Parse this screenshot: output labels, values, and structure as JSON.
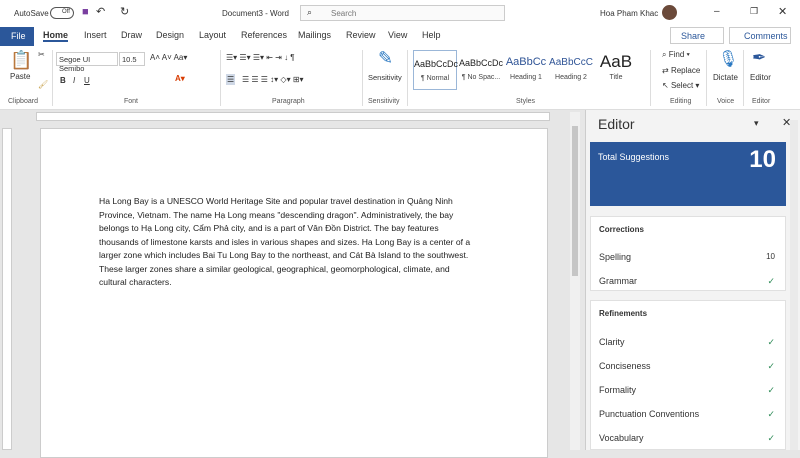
{
  "titlebar": {
    "autosave": "AutoSave",
    "toggle": "Off",
    "doc_title": "Document3 - Word",
    "search_placeholder": "Search",
    "user": "Hoa Pham Khac"
  },
  "tabs": [
    "File",
    "Home",
    "Insert",
    "Draw",
    "Design",
    "Layout",
    "References",
    "Mailings",
    "Review",
    "View",
    "Help"
  ],
  "share": "Share",
  "comments": "Comments",
  "ribbon": {
    "paste": "Paste",
    "font": "Segoe UI Semibo",
    "size": "10.5",
    "styles": [
      {
        "sample": "AaBbCcDc",
        "label": "¶ Normal"
      },
      {
        "sample": "AaBbCcDc",
        "label": "¶ No Spac..."
      },
      {
        "sample": "AaBbCc",
        "label": "Heading 1"
      },
      {
        "sample": "AaBbCcC",
        "label": "Heading 2"
      },
      {
        "sample": "AaB",
        "label": "Title"
      }
    ],
    "find": "Find",
    "replace": "Replace",
    "select": "Select",
    "sensitivity": "Sensitivity",
    "dictate": "Dictate",
    "editor": "Editor",
    "groups": [
      "Clipboard",
      "Font",
      "Paragraph",
      "Sensitivity",
      "Styles",
      "Editing",
      "Voice",
      "Editor"
    ]
  },
  "document": {
    "lines": [
      "Ha Long Bay is a UNESCO World Heritage Site and popular travel destination in Quảng Ninh",
      "Province, Vietnam. The name Hạ Long means \"descending dragon\". Administratively, the bay",
      "belongs to Hạ Long city, Cẩm Phả city, and is a part of Vân Đồn District. The bay features",
      "thousands of limestone karsts and isles in various shapes and sizes. Ha Long Bay is a center of a",
      "larger zone which includes Bai Tu Long Bay to the northeast, and Cát Bà Island to the southwest.",
      "These larger zones share a similar geological, geographical, geomorphological, climate, and",
      "cultural characters."
    ]
  },
  "editor": {
    "title": "Editor",
    "total_label": "Total Suggestions",
    "total": "10",
    "corrections": "Corrections",
    "spelling": "Spelling",
    "spelling_count": "10",
    "grammar": "Grammar",
    "refinements": "Refinements",
    "items": [
      "Clarity",
      "Conciseness",
      "Formality",
      "Punctuation Conventions",
      "Vocabulary"
    ]
  },
  "colors": {
    "accent": "#2b579a",
    "total_bg": "#2b579a"
  }
}
